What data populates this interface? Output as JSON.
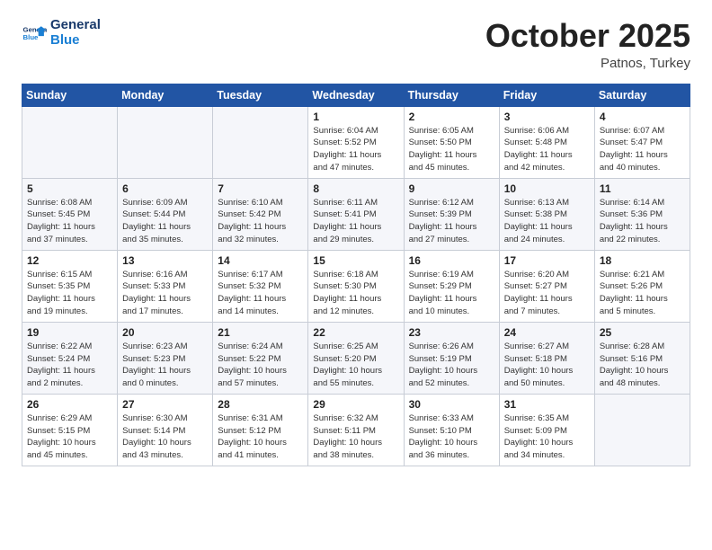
{
  "header": {
    "logo_general": "General",
    "logo_blue": "Blue",
    "month": "October 2025",
    "location": "Patnos, Turkey"
  },
  "days_of_week": [
    "Sunday",
    "Monday",
    "Tuesday",
    "Wednesday",
    "Thursday",
    "Friday",
    "Saturday"
  ],
  "weeks": [
    [
      {
        "day": "",
        "info": ""
      },
      {
        "day": "",
        "info": ""
      },
      {
        "day": "",
        "info": ""
      },
      {
        "day": "1",
        "info": "Sunrise: 6:04 AM\nSunset: 5:52 PM\nDaylight: 11 hours\nand 47 minutes."
      },
      {
        "day": "2",
        "info": "Sunrise: 6:05 AM\nSunset: 5:50 PM\nDaylight: 11 hours\nand 45 minutes."
      },
      {
        "day": "3",
        "info": "Sunrise: 6:06 AM\nSunset: 5:48 PM\nDaylight: 11 hours\nand 42 minutes."
      },
      {
        "day": "4",
        "info": "Sunrise: 6:07 AM\nSunset: 5:47 PM\nDaylight: 11 hours\nand 40 minutes."
      }
    ],
    [
      {
        "day": "5",
        "info": "Sunrise: 6:08 AM\nSunset: 5:45 PM\nDaylight: 11 hours\nand 37 minutes."
      },
      {
        "day": "6",
        "info": "Sunrise: 6:09 AM\nSunset: 5:44 PM\nDaylight: 11 hours\nand 35 minutes."
      },
      {
        "day": "7",
        "info": "Sunrise: 6:10 AM\nSunset: 5:42 PM\nDaylight: 11 hours\nand 32 minutes."
      },
      {
        "day": "8",
        "info": "Sunrise: 6:11 AM\nSunset: 5:41 PM\nDaylight: 11 hours\nand 29 minutes."
      },
      {
        "day": "9",
        "info": "Sunrise: 6:12 AM\nSunset: 5:39 PM\nDaylight: 11 hours\nand 27 minutes."
      },
      {
        "day": "10",
        "info": "Sunrise: 6:13 AM\nSunset: 5:38 PM\nDaylight: 11 hours\nand 24 minutes."
      },
      {
        "day": "11",
        "info": "Sunrise: 6:14 AM\nSunset: 5:36 PM\nDaylight: 11 hours\nand 22 minutes."
      }
    ],
    [
      {
        "day": "12",
        "info": "Sunrise: 6:15 AM\nSunset: 5:35 PM\nDaylight: 11 hours\nand 19 minutes."
      },
      {
        "day": "13",
        "info": "Sunrise: 6:16 AM\nSunset: 5:33 PM\nDaylight: 11 hours\nand 17 minutes."
      },
      {
        "day": "14",
        "info": "Sunrise: 6:17 AM\nSunset: 5:32 PM\nDaylight: 11 hours\nand 14 minutes."
      },
      {
        "day": "15",
        "info": "Sunrise: 6:18 AM\nSunset: 5:30 PM\nDaylight: 11 hours\nand 12 minutes."
      },
      {
        "day": "16",
        "info": "Sunrise: 6:19 AM\nSunset: 5:29 PM\nDaylight: 11 hours\nand 10 minutes."
      },
      {
        "day": "17",
        "info": "Sunrise: 6:20 AM\nSunset: 5:27 PM\nDaylight: 11 hours\nand 7 minutes."
      },
      {
        "day": "18",
        "info": "Sunrise: 6:21 AM\nSunset: 5:26 PM\nDaylight: 11 hours\nand 5 minutes."
      }
    ],
    [
      {
        "day": "19",
        "info": "Sunrise: 6:22 AM\nSunset: 5:24 PM\nDaylight: 11 hours\nand 2 minutes."
      },
      {
        "day": "20",
        "info": "Sunrise: 6:23 AM\nSunset: 5:23 PM\nDaylight: 11 hours\nand 0 minutes."
      },
      {
        "day": "21",
        "info": "Sunrise: 6:24 AM\nSunset: 5:22 PM\nDaylight: 10 hours\nand 57 minutes."
      },
      {
        "day": "22",
        "info": "Sunrise: 6:25 AM\nSunset: 5:20 PM\nDaylight: 10 hours\nand 55 minutes."
      },
      {
        "day": "23",
        "info": "Sunrise: 6:26 AM\nSunset: 5:19 PM\nDaylight: 10 hours\nand 52 minutes."
      },
      {
        "day": "24",
        "info": "Sunrise: 6:27 AM\nSunset: 5:18 PM\nDaylight: 10 hours\nand 50 minutes."
      },
      {
        "day": "25",
        "info": "Sunrise: 6:28 AM\nSunset: 5:16 PM\nDaylight: 10 hours\nand 48 minutes."
      }
    ],
    [
      {
        "day": "26",
        "info": "Sunrise: 6:29 AM\nSunset: 5:15 PM\nDaylight: 10 hours\nand 45 minutes."
      },
      {
        "day": "27",
        "info": "Sunrise: 6:30 AM\nSunset: 5:14 PM\nDaylight: 10 hours\nand 43 minutes."
      },
      {
        "day": "28",
        "info": "Sunrise: 6:31 AM\nSunset: 5:12 PM\nDaylight: 10 hours\nand 41 minutes."
      },
      {
        "day": "29",
        "info": "Sunrise: 6:32 AM\nSunset: 5:11 PM\nDaylight: 10 hours\nand 38 minutes."
      },
      {
        "day": "30",
        "info": "Sunrise: 6:33 AM\nSunset: 5:10 PM\nDaylight: 10 hours\nand 36 minutes."
      },
      {
        "day": "31",
        "info": "Sunrise: 6:35 AM\nSunset: 5:09 PM\nDaylight: 10 hours\nand 34 minutes."
      },
      {
        "day": "",
        "info": ""
      }
    ]
  ]
}
